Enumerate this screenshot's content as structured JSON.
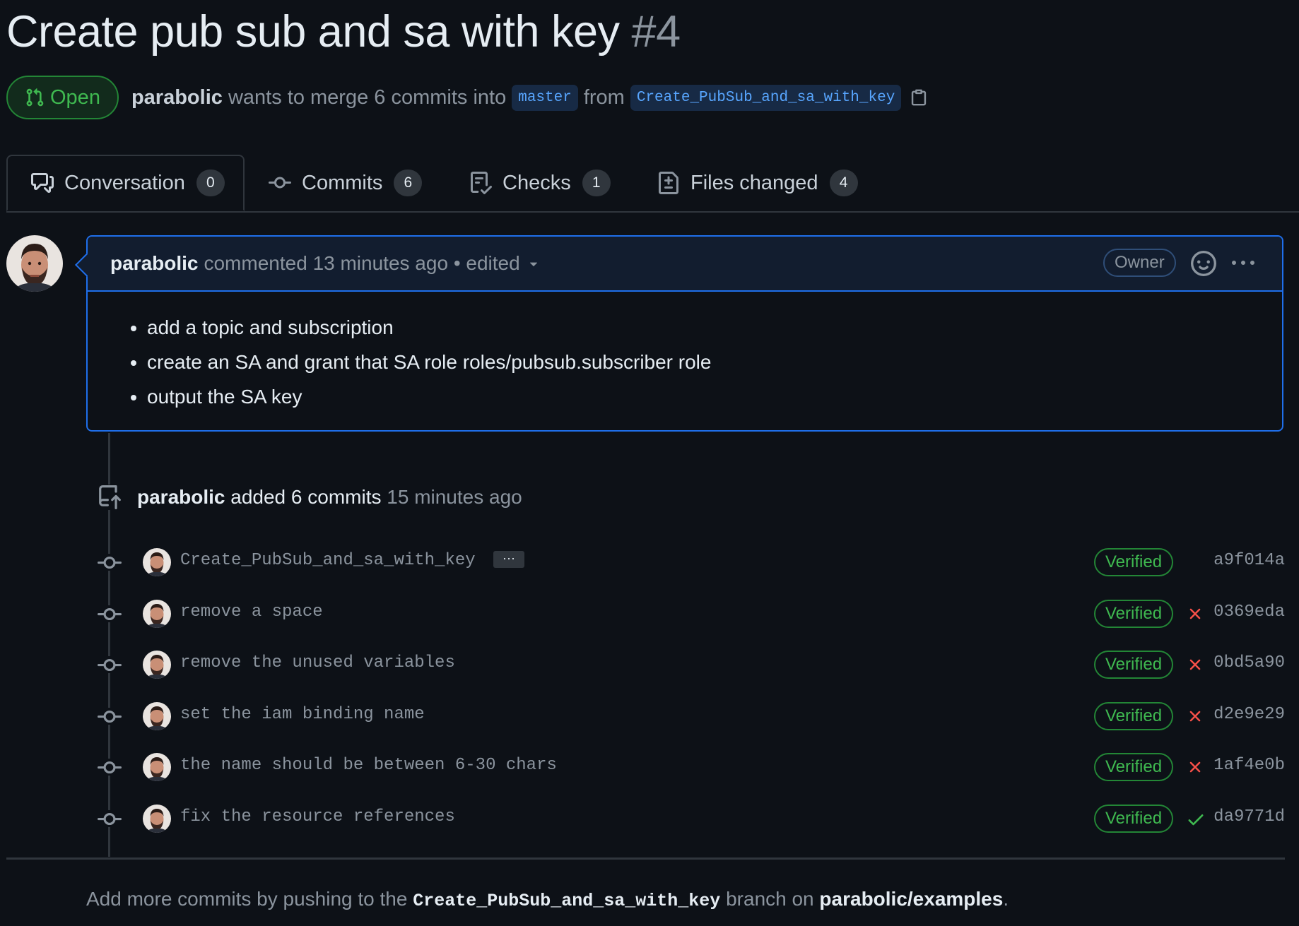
{
  "pr": {
    "title": "Create pub sub and sa with key",
    "number": "#4",
    "state": "Open",
    "author": "parabolic",
    "merge_text": "wants to merge 6 commits into",
    "base_branch": "master",
    "from_text": "from",
    "head_branch": "Create_PubSub_and_sa_with_key"
  },
  "tabs": [
    {
      "label": "Conversation",
      "count": "0",
      "icon": "comment-discussion-icon"
    },
    {
      "label": "Commits",
      "count": "6",
      "icon": "git-commit-icon"
    },
    {
      "label": "Checks",
      "count": "1",
      "icon": "checklist-icon"
    },
    {
      "label": "Files changed",
      "count": "4",
      "icon": "file-diff-icon"
    }
  ],
  "comment": {
    "author": "parabolic",
    "action": "commented",
    "time": "13 minutes ago",
    "edited": "• edited",
    "role": "Owner",
    "items": [
      "add a topic and subscription",
      "create an SA and grant that SA role roles/pubsub.subscriber role",
      "output the SA key"
    ]
  },
  "push_event": {
    "author": "parabolic",
    "action": "added 6 commits",
    "time": "15 minutes ago"
  },
  "commits": [
    {
      "message": "Create_PubSub_and_sa_with_key",
      "verified": "Verified",
      "status": "none",
      "sha": "a9f014a",
      "has_ellipsis": true
    },
    {
      "message": "remove a space",
      "verified": "Verified",
      "status": "failure",
      "sha": "0369eda"
    },
    {
      "message": "remove the unused variables",
      "verified": "Verified",
      "status": "failure",
      "sha": "0bd5a90"
    },
    {
      "message": "set the iam binding name",
      "verified": "Verified",
      "status": "failure",
      "sha": "d2e9e29"
    },
    {
      "message": "the name should be between 6-30 chars",
      "verified": "Verified",
      "status": "failure",
      "sha": "1af4e0b"
    },
    {
      "message": "fix the resource references",
      "verified": "Verified",
      "status": "success",
      "sha": "da9771d"
    }
  ],
  "ellipsis_label": "···",
  "footer": {
    "prefix": "Add more commits by pushing to the",
    "branch": "Create_PubSub_and_sa_with_key",
    "middle": "branch on",
    "repo": "parabolic/examples",
    "suffix": "."
  },
  "colors": {
    "background": "#0d1117",
    "success": "#3fb950",
    "danger": "#f85149",
    "accent": "#1f6feb",
    "link": "#58a6ff"
  }
}
